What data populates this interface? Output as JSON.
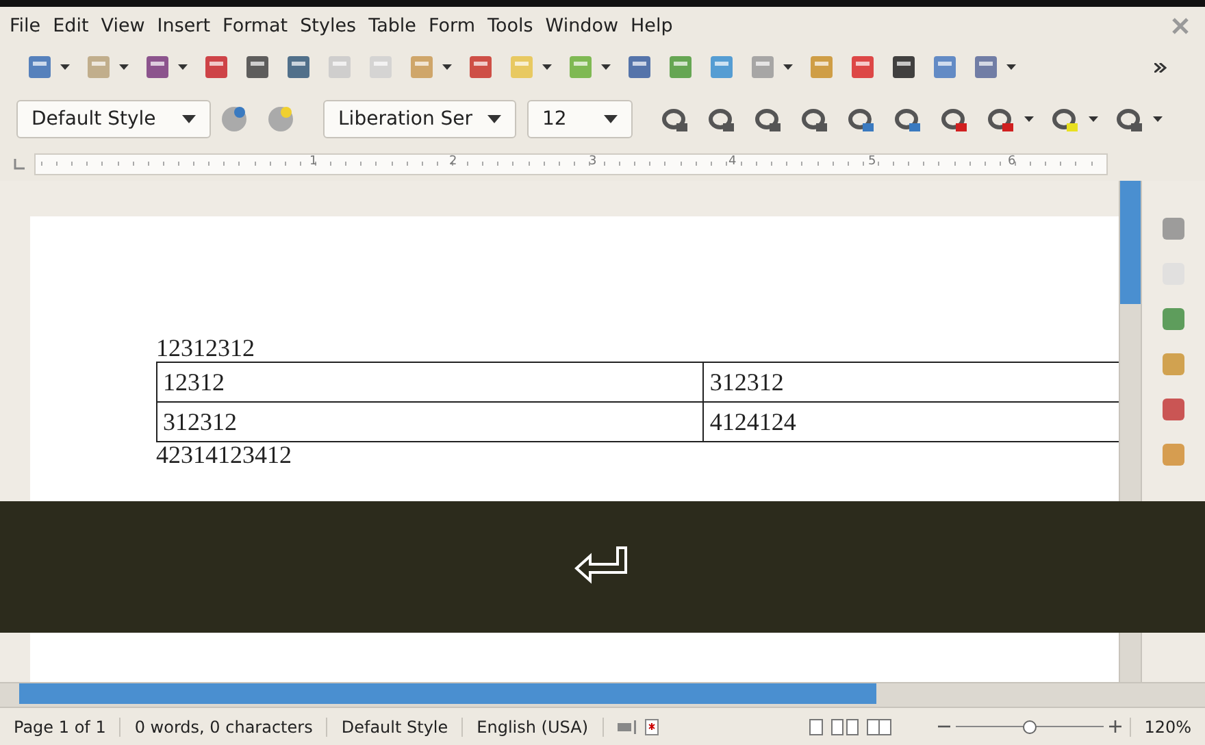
{
  "menu_bar": [
    "File",
    "Edit",
    "View",
    "Insert",
    "Format",
    "Styles",
    "Table",
    "Form",
    "Tools",
    "Window",
    "Help"
  ],
  "formatting_toolbar": {
    "paragraph_style": "Default Style",
    "font_name": "Liberation Ser",
    "font_size": "12"
  },
  "ruler": {
    "marks": [
      "1",
      "2",
      "3",
      "4",
      "5",
      "6"
    ]
  },
  "document": {
    "paragraph_before": "12312312",
    "table": {
      "rows": [
        [
          "12312",
          "312312"
        ],
        [
          "312312",
          "4124124"
        ]
      ]
    },
    "paragraph_after": "42314123412"
  },
  "status_bar": {
    "page": "Page 1 of 1",
    "words": "0 words, 0 characters",
    "page_style": "Default Style",
    "language": "English (USA)",
    "zoom_slider": {
      "level": 0.5
    },
    "zoom": "120%"
  }
}
